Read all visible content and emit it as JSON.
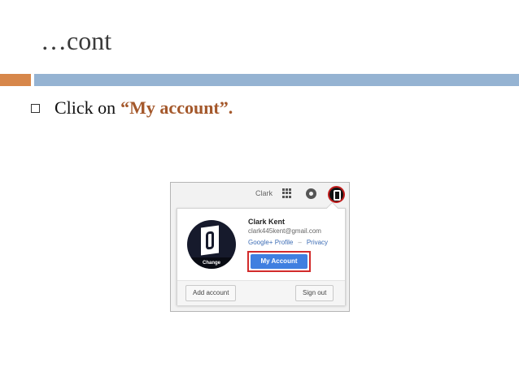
{
  "slide": {
    "title": "…cont",
    "bullet_prefix": "Click on",
    "bullet_accent": "“My account”.",
    "accent_color": "#a4582b",
    "bar_colors": {
      "left": "#d7874a",
      "right": "#95b3d2"
    }
  },
  "screenshot": {
    "topbar": {
      "user_name": "Clark",
      "apps_icon": "apps-grid-icon",
      "notifications_icon": "notifications-icon",
      "avatar_icon": "profile-avatar-icon"
    },
    "account_card": {
      "avatar_change_label": "Change",
      "name": "Clark Kent",
      "email": "clark445kent@gmail.com",
      "profile_link": "Google+ Profile",
      "separator": "–",
      "privacy_link": "Privacy",
      "my_account_button": "My Account",
      "add_account_button": "Add account",
      "sign_out_button": "Sign out",
      "highlight_color": "#d22b2b",
      "button_color": "#3f7fe0"
    }
  }
}
